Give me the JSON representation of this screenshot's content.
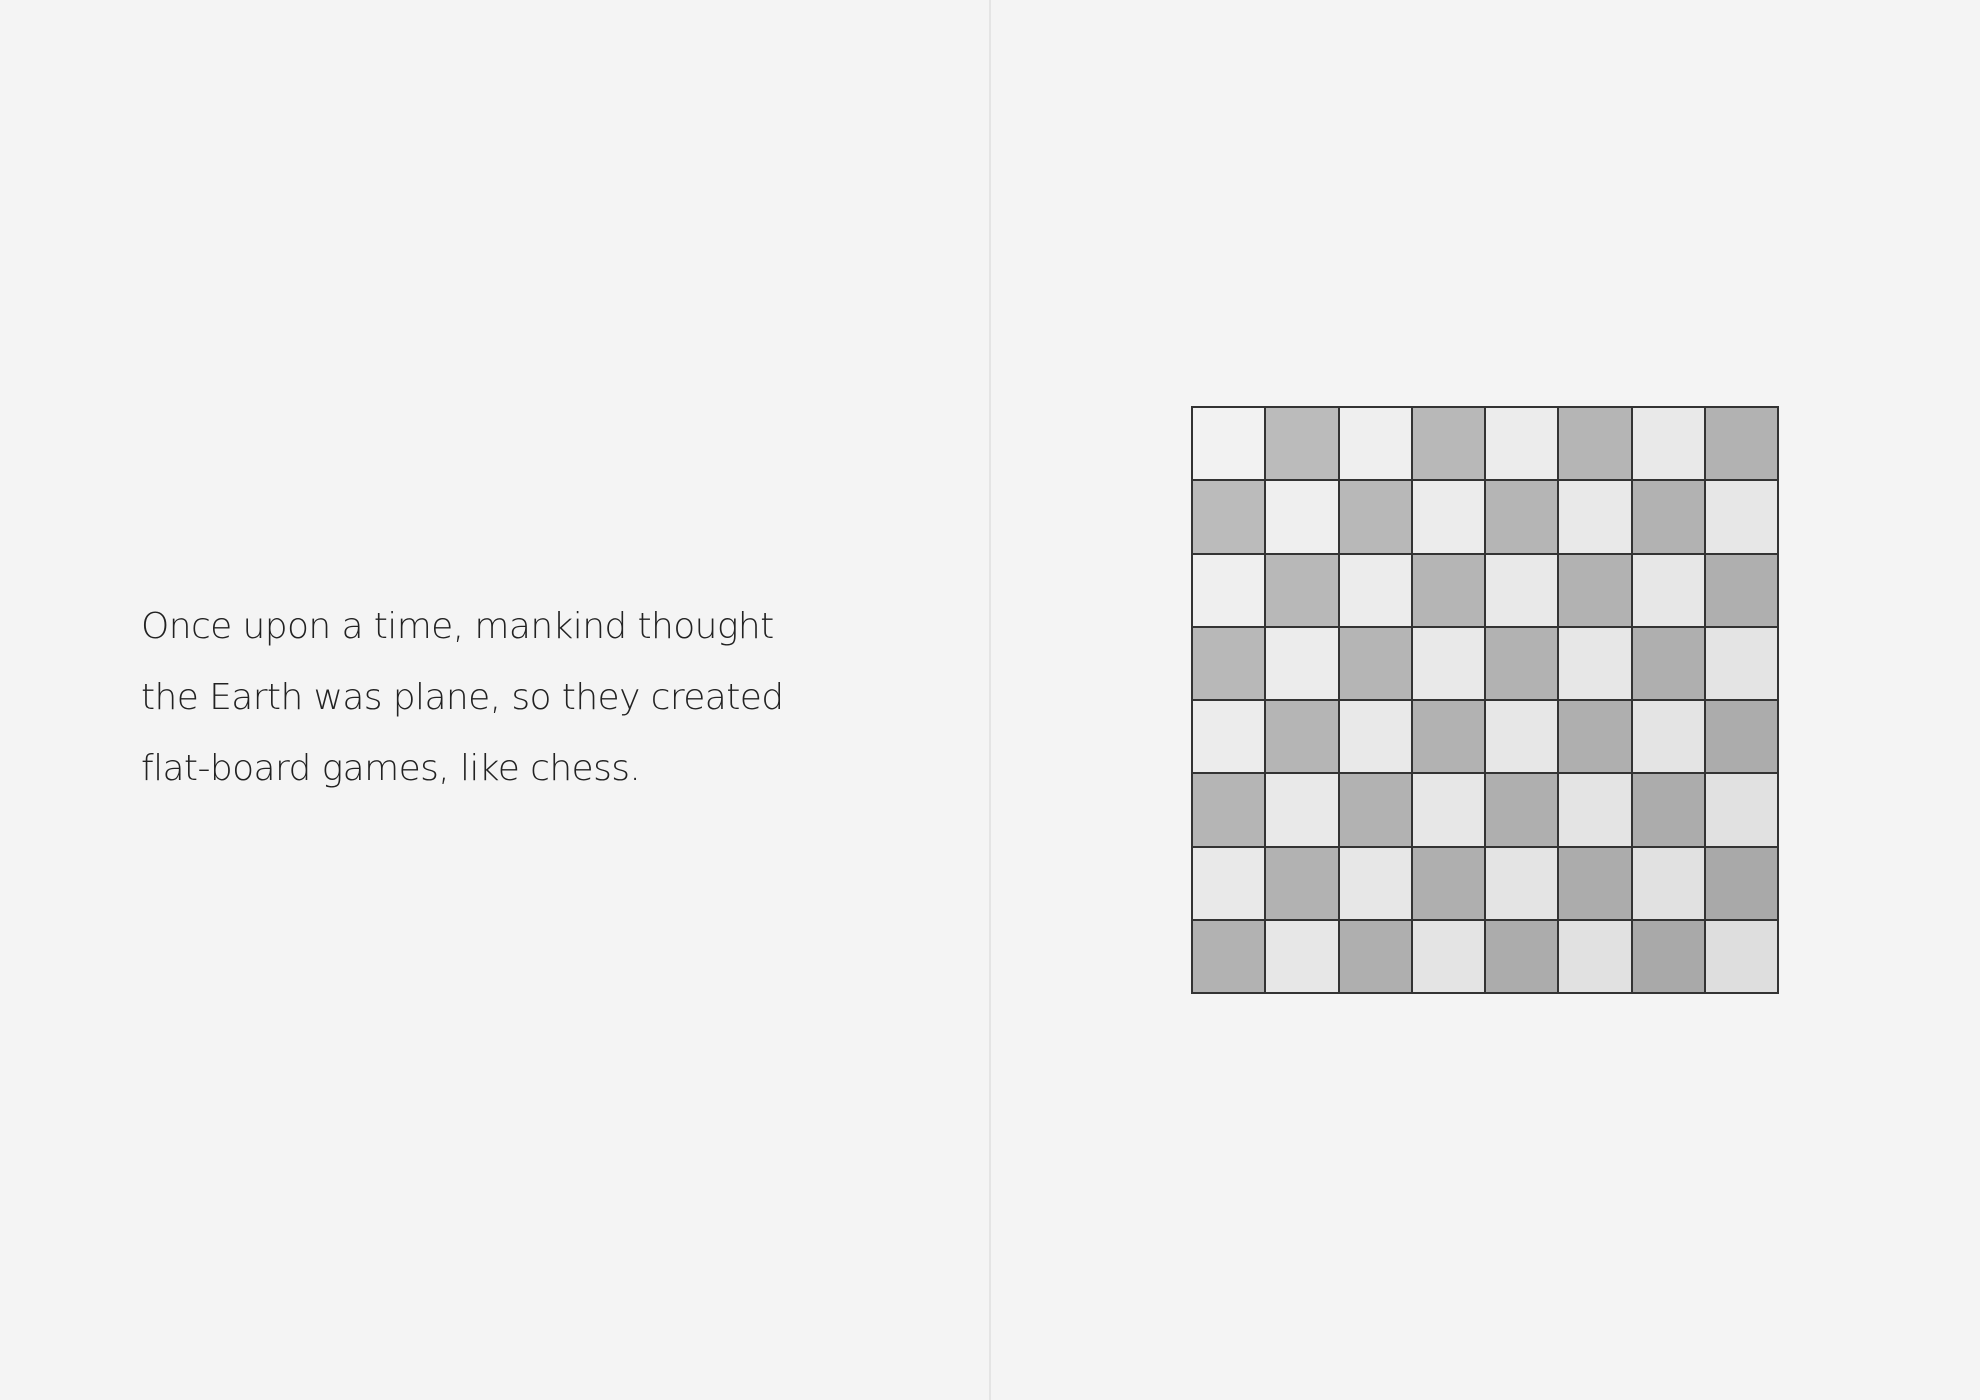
{
  "story": {
    "lines": [
      "Once upon a time, mankind thought",
      "the Earth was plane, so they created",
      "flat-board games, like chess."
    ]
  },
  "board": {
    "rows": 8,
    "cols": 8,
    "light_color": "#f2f2f2",
    "light_color_end": "#dedede",
    "dark_color": "#bcbcbc",
    "dark_color_end": "#a8a8a8",
    "grid_line_color": "#333333"
  },
  "colors": {
    "background": "#f4f4f4",
    "gutter": "#e4e4e4",
    "text": "#222222"
  }
}
